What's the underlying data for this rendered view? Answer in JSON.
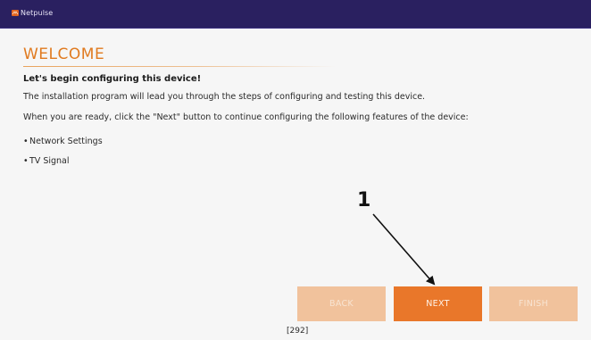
{
  "app": {
    "name": "Netpulse",
    "accent_color": "#e07a1f",
    "titlebar_color": "#2a2060"
  },
  "welcome": {
    "heading": "WELCOME",
    "subheading": "Let's begin configuring this device!",
    "paragraph_1": "The installation program will lead you through the steps of configuring and testing this device.",
    "paragraph_2": "When you are ready, click the \"Next\" button to continue configuring the following features of the device:",
    "features": [
      {
        "bullet": "•",
        "label": "Network Settings"
      },
      {
        "bullet": "•",
        "label": "TV Signal"
      }
    ]
  },
  "annotation": {
    "callout_number": "1"
  },
  "buttons": {
    "back_label": "BACK",
    "next_label": "NEXT",
    "finish_label": "FINISH",
    "back_enabled": false,
    "next_enabled": true,
    "finish_enabled": false
  },
  "page_reference": "[292]"
}
